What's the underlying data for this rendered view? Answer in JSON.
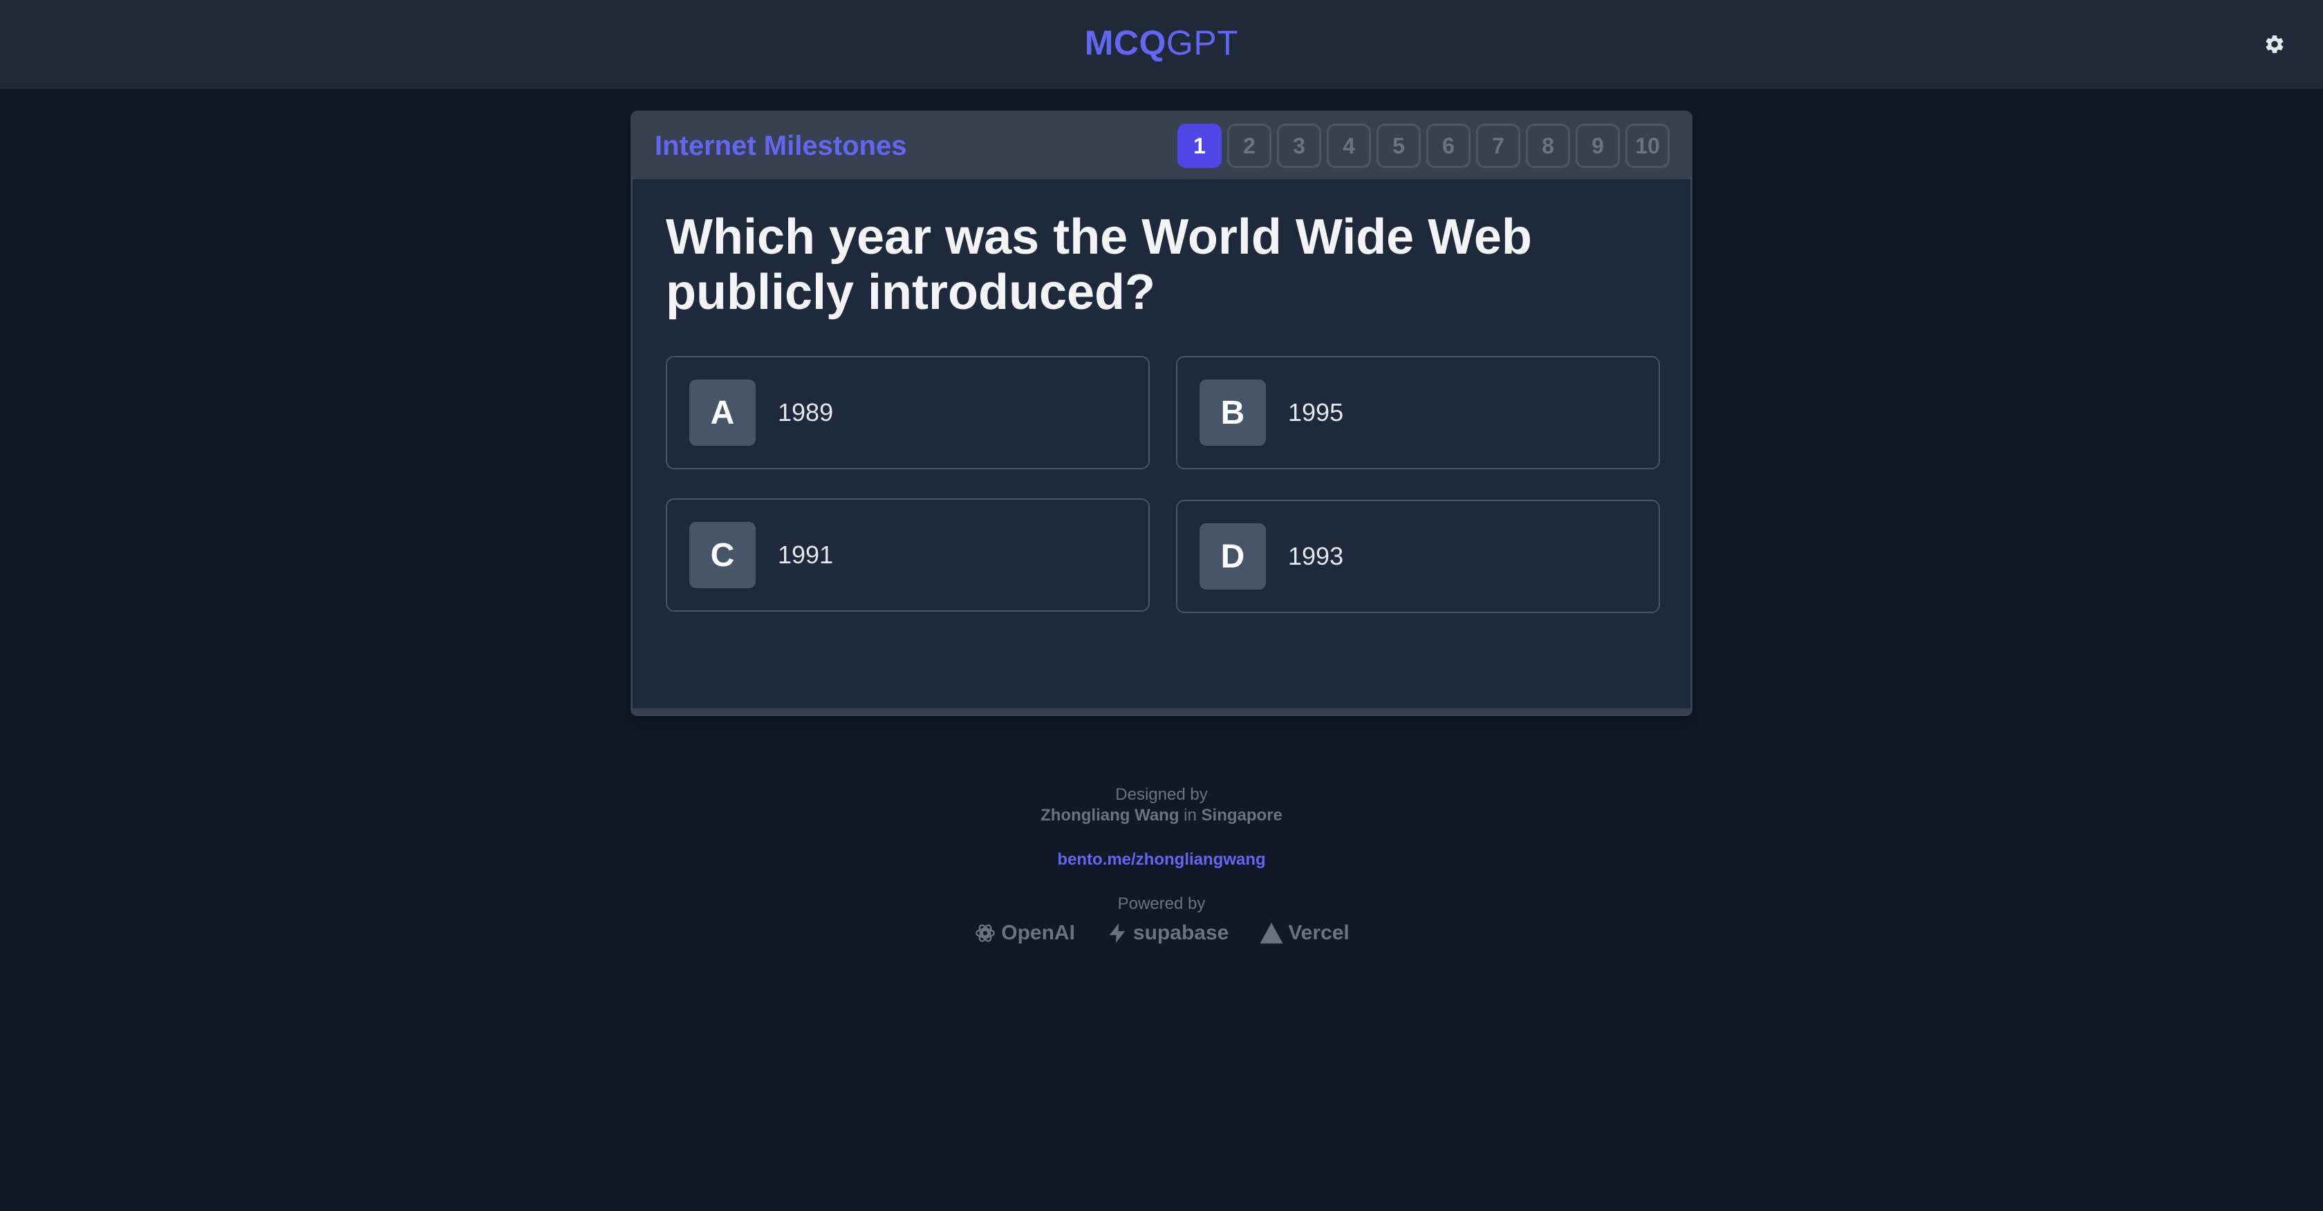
{
  "header": {
    "brand_part1": "MCQ",
    "brand_part2": "GPT",
    "settings_icon": "gear-icon"
  },
  "quiz": {
    "title": "Internet Milestones",
    "pages": [
      "1",
      "2",
      "3",
      "4",
      "5",
      "6",
      "7",
      "8",
      "9",
      "10"
    ],
    "active_page": "1",
    "question": "Which year was the World Wide Web publicly introduced?",
    "options": [
      {
        "letter": "A",
        "text": "1989"
      },
      {
        "letter": "B",
        "text": "1995"
      },
      {
        "letter": "C",
        "text": "1991"
      },
      {
        "letter": "D",
        "text": "1993"
      }
    ]
  },
  "footer": {
    "designed_by": "Designed by",
    "author": "Zhongliang Wang",
    "in_text": "in",
    "location": "Singapore",
    "link": "bento.me/zhongliangwang",
    "powered_by": "Powered by",
    "sponsors": [
      {
        "name": "OpenAI",
        "icon": "openai-logo-icon"
      },
      {
        "name": "supabase",
        "icon": "supabase-logo-icon"
      },
      {
        "name": "Vercel",
        "icon": "vercel-logo-icon"
      }
    ]
  },
  "colors": {
    "accent": "#6366f1",
    "active_page": "#4f46e5",
    "background": "#111827",
    "card": "#1e293b"
  }
}
